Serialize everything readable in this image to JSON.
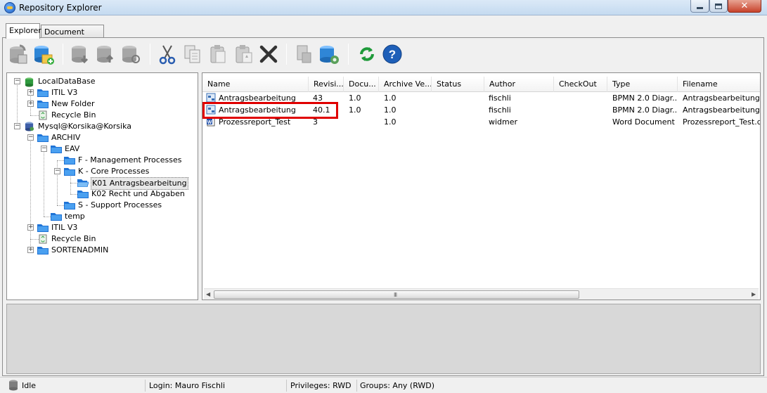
{
  "window": {
    "title": "Repository Explorer"
  },
  "tabs": [
    {
      "label": "Explorer",
      "active": true
    },
    {
      "label": "Document Finder",
      "active": false
    }
  ],
  "toolbar": {
    "icons": [
      "checkout-db-icon",
      "add-db-icon",
      "download-icon",
      "upload-icon",
      "refresh-db-icon",
      "cut-icon",
      "copy-icon",
      "paste-icon",
      "paste-special-icon",
      "delete-icon",
      "doc-lock-icon",
      "db-settings-icon",
      "refresh-icon",
      "help-icon"
    ]
  },
  "tree": {
    "nodes": [
      {
        "label": "LocalDataBase"
      },
      {
        "label": "ITIL V3"
      },
      {
        "label": "New Folder"
      },
      {
        "label": "Recycle Bin"
      },
      {
        "label": "Mysql@Korsika@Korsika"
      },
      {
        "label": "ARCHIV"
      },
      {
        "label": "EAV"
      },
      {
        "label": "F - Management Processes"
      },
      {
        "label": "K - Core Processes"
      },
      {
        "label": "K01 Antragsbearbeitung"
      },
      {
        "label": "K02 Recht und Abgaben"
      },
      {
        "label": "S - Support Processes"
      },
      {
        "label": "temp"
      },
      {
        "label": "ITIL V3"
      },
      {
        "label": "Recycle Bin"
      },
      {
        "label": "SORTENADMIN"
      }
    ]
  },
  "list": {
    "columns": [
      "Name",
      "Revisi...",
      "Docu...",
      "Archive Ve...",
      "Status",
      "Author",
      "CheckOut",
      "Type",
      "Filename"
    ],
    "rows": [
      {
        "name": "Antragsbearbeitung",
        "revision": "43",
        "doc": "1.0",
        "archive": "1.0",
        "status": "",
        "author": "fischli",
        "checkout": "",
        "type": "BPMN 2.0 Diagr...",
        "filename": "Antragsbearbeitung.vsd"
      },
      {
        "name": "Antragsbearbeitung",
        "revision": "40.1",
        "doc": "1.0",
        "archive": "1.0",
        "status": "",
        "author": "fischli",
        "checkout": "",
        "type": "BPMN 2.0 Diagr...",
        "filename": "Antragsbearbeitung.vsd"
      },
      {
        "name": "Prozessreport_Test",
        "revision": "3",
        "doc": "",
        "archive": "1.0",
        "status": "",
        "author": "widmer",
        "checkout": "",
        "type": "Word Document",
        "filename": "Prozessreport_Test.doc"
      }
    ],
    "scroll_grip": "III"
  },
  "status": {
    "state": "Idle",
    "login": "Login: Mauro Fischli",
    "privileges": "Privileges: RWD",
    "groups": "Groups: Any (RWD)"
  }
}
